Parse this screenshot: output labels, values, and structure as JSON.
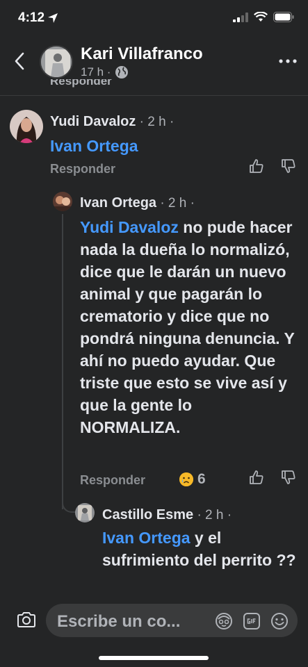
{
  "status_bar": {
    "time": "4:12"
  },
  "header": {
    "name": "Kari Villafranco",
    "age": "17 h ·"
  },
  "clipped_reply_label": "Responder",
  "comments": [
    {
      "author": "Yudi Davaloz",
      "time": " · 2 h ·",
      "mention": "Ivan Ortega",
      "text": "",
      "reply_label": "Responder"
    },
    {
      "author": "Ivan Ortega",
      "time": " · 2 h ·",
      "mention": "Yudi Davaloz",
      "text": " no pude hacer nada la dueña lo normalizó, dice que le darán un nuevo animal y que pagarán lo crematorio y dice que no pondrá ninguna denuncia. Y ahí no puedo ayudar. Que triste que esto se vive así y que la gente lo NORMALIZA.",
      "reply_label": "Responder",
      "reaction_count": "6"
    },
    {
      "author": "Castillo Esme",
      "time": " · 2 h ·",
      "mention": "Ivan Ortega",
      "text": " y el sufrimiento del perrito ??"
    }
  ],
  "composer": {
    "placeholder": "Escribe un co..."
  },
  "colors": {
    "background": "#242526",
    "mention": "#4599ff",
    "muted": "#b0b3b8"
  }
}
